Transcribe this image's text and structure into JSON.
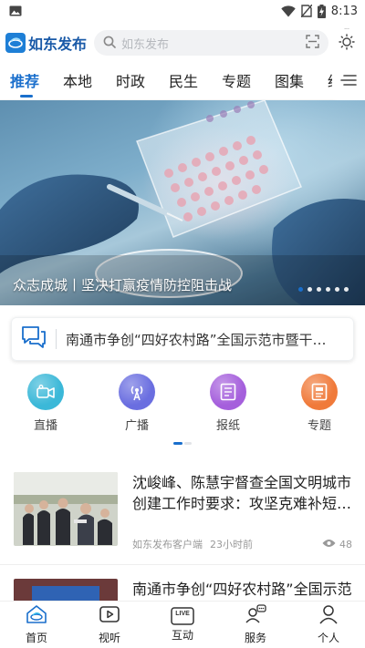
{
  "status_bar": {
    "time": "8:13"
  },
  "header": {
    "app_name": "如东发布",
    "search_placeholder": "如东发布",
    "weather_text": "···"
  },
  "tabs": [
    {
      "label": "推荐",
      "active": true
    },
    {
      "label": "本地"
    },
    {
      "label": "时政"
    },
    {
      "label": "民生"
    },
    {
      "label": "专题"
    },
    {
      "label": "图集"
    },
    {
      "label": "经"
    }
  ],
  "banner": {
    "caption": "众志成城丨坚决打赢疫情防控阻击战",
    "slide_count": 6,
    "active_slide": 1
  },
  "notice": {
    "text": "南通市争创“四好农村路”全国示范市暨干…"
  },
  "quick_entries": [
    {
      "label": "直播",
      "icon": "video-camera-icon",
      "color": "#3bb8d8"
    },
    {
      "label": "广播",
      "icon": "broadcast-tower-icon",
      "color": "#6a6ee0"
    },
    {
      "label": "报纸",
      "icon": "newspaper-icon",
      "color": "#a55fdc"
    },
    {
      "label": "专题",
      "icon": "topic-document-icon",
      "color": "#f07a3a"
    }
  ],
  "news": [
    {
      "title": "沈峻峰、陈慧宇督查全国文明城市创建工作时要求：攻坚克难补短…",
      "source": "如东发布客户端",
      "time": "23小时前",
      "views": "48"
    },
    {
      "title": "南通市争创“四好农村路”全国示范市暨干线公路迎“国检”工作推进…",
      "source": "",
      "time": "",
      "views": ""
    }
  ],
  "bottom_nav": [
    {
      "label": "首页",
      "icon": "home-icon",
      "active": true
    },
    {
      "label": "视听",
      "icon": "play-icon"
    },
    {
      "label": "互动",
      "icon": "live-icon",
      "icon_text": "LIVE"
    },
    {
      "label": "服务",
      "icon": "service-icon"
    },
    {
      "label": "个人",
      "icon": "person-icon"
    }
  ],
  "colors": {
    "accent": "#1a6fcc"
  }
}
